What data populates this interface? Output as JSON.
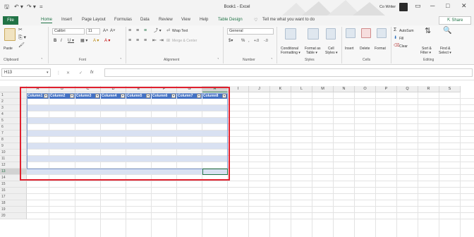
{
  "titlebar": {
    "title": "Book1 - Excel",
    "user": "Co Writer",
    "save_icon": "save-icon",
    "undo_icon": "undo-icon",
    "redo_icon": "redo-icon",
    "qat_glyph_save": "🖫",
    "qat_glyph_undo": "↶ ▾",
    "qat_glyph_redo": "↷ ▾",
    "qat_glyph_more": "=",
    "win_ribbon_opts": "▭",
    "win_min": "─",
    "win_max": "□",
    "win_close": "✕"
  },
  "tabs": {
    "file": "File",
    "items": [
      "Home",
      "Insert",
      "Page Layout",
      "Formulas",
      "Data",
      "Review",
      "View",
      "Help",
      "Table Design"
    ],
    "active": "Home",
    "tell_me": "Tell me what you want to do",
    "share": "Share",
    "tell_me_glyph": "♡",
    "share_glyph": "⇱"
  },
  "ribbon": {
    "clipboard": {
      "paste": "Paste",
      "label": "Clipboard"
    },
    "font": {
      "name": "Calibri",
      "size": "11",
      "label": "Font"
    },
    "alignment": {
      "wrap": "Wrap Text",
      "merge": "Merge & Center",
      "label": "Alignment"
    },
    "number": {
      "format": "General",
      "label": "Number"
    },
    "styles": {
      "cond": "Conditional Formatting",
      "cond_line1": "Conditional",
      "cond_line2": "Formatting ▾",
      "format_table": "Format as Table",
      "ft_line1": "Format as",
      "ft_line2": "Table ▾",
      "cell_styles": "Cell Styles",
      "cs_line1": "Cell",
      "cs_line2": "Styles ▾",
      "label": "Styles"
    },
    "cells": {
      "insert": "Insert",
      "delete": "Delete",
      "format": "Format",
      "label": "Cells"
    },
    "editing": {
      "autosum": "AutoSum",
      "fill": "Fill",
      "clear": "Clear",
      "sort": "Sort & Filter",
      "sort_line1": "Sort &",
      "sort_line2": "Filter ▾",
      "find": "Find & Select",
      "find_line1": "Find &",
      "find_line2": "Select ▾",
      "label": "Editing"
    },
    "glyphs": {
      "grow": "A˄",
      "shrink": "A˅",
      "bold": "B",
      "italic": "I",
      "underline": "U ▾",
      "borders": "▦ ▾",
      "fill": "A ▾",
      "fontcolor": "A ▾",
      "align_top": "≡",
      "align_mid": "≡",
      "align_bot": "≡",
      "orient": "⤴ ▾",
      "wrap": "⏎",
      "merge": "⊞",
      "align_l": "≡",
      "align_c": "≡",
      "align_r": "≡",
      "indent_dec": "⇤",
      "indent_inc": "⇥",
      "currency": "$▾",
      "percent": "%",
      "comma": ",",
      "dec_inc": "+.0",
      "dec_dec": "-.0",
      "autosum": "Σ",
      "fill_i": "⬇",
      "clear_i": "⌫",
      "sort": "⇅",
      "find": "🔍",
      "launcher": "⌝",
      "dropdown": "▾",
      "combo_dd": "▾",
      "grow_glyph": "▾",
      "copy": "⎘ ▾",
      "format_painter": "🖌",
      "cut": "✂"
    }
  },
  "formula_bar": {
    "name_box": "H13",
    "cancel_glyph": "✕",
    "enter_glyph": "✓",
    "fx_glyph": "fx",
    "dots_glyph": "⋮",
    "dd_glyph": "▾",
    "formula": ""
  },
  "grid": {
    "columns": [
      "A",
      "B",
      "C",
      "D",
      "E",
      "F",
      "G",
      "H",
      "I",
      "J",
      "K",
      "L",
      "M",
      "N",
      "O",
      "P",
      "Q",
      "R",
      "S"
    ],
    "selected_column": "H",
    "rows": [
      "1",
      "2",
      "3",
      "4",
      "5",
      "6",
      "7",
      "8",
      "9",
      "10",
      "11",
      "12",
      "13",
      "14",
      "15",
      "16",
      "17",
      "18",
      "19",
      "20"
    ],
    "selected_row": "13",
    "active_cell": "H13",
    "table_headers": [
      "Column1",
      "Column2",
      "Column3",
      "Column4",
      "Column5",
      "Column6",
      "Column7",
      "Column8"
    ],
    "filter_glyph": "▾"
  },
  "colors": {
    "accent": "#217346",
    "table_header": "#4472c4",
    "table_band": "#d9e1f2",
    "highlight_box": "#e0202e"
  }
}
